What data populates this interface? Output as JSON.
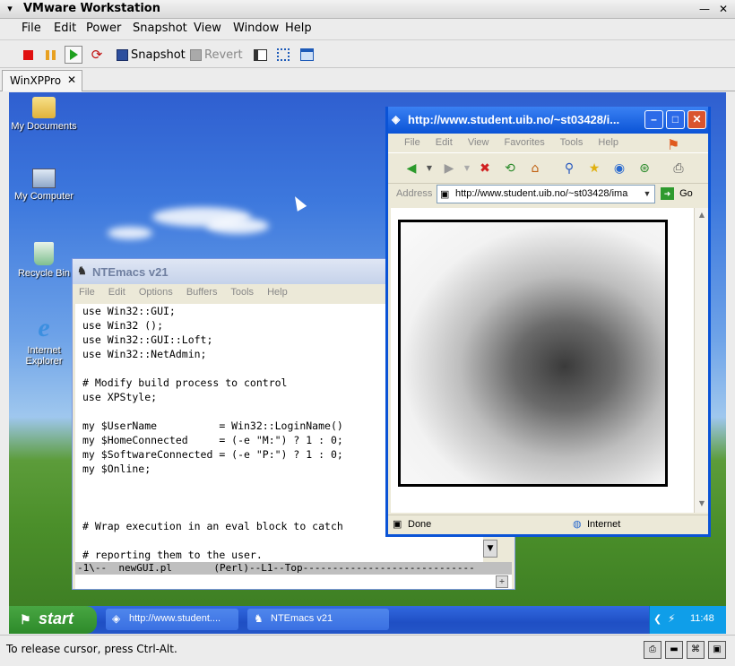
{
  "host": {
    "title": "VMware Workstation",
    "title_controls": {
      "minimize": "—",
      "close": "✕"
    },
    "menu": [
      "File",
      "Edit",
      "Power",
      "Snapshot",
      "View",
      "Window",
      "Help"
    ],
    "toolbar": {
      "snapshot_label": "Snapshot",
      "revert_label": "Revert"
    },
    "tab": {
      "label": "WinXPPro",
      "close": "✕"
    },
    "status_message": "To release cursor, press Ctrl-Alt."
  },
  "desktop": {
    "icons": [
      {
        "label_lines": [
          "My Documents"
        ],
        "icon": "folder-icon"
      },
      {
        "label_lines": [
          "My Computer"
        ],
        "icon": "computer-icon"
      },
      {
        "label_lines": [
          "Recycle Bin"
        ],
        "icon": "recycle-bin-icon"
      },
      {
        "label_lines": [
          "Internet",
          "Explorer"
        ],
        "icon": "internet-explorer-icon"
      }
    ]
  },
  "emacs": {
    "title": "NTEmacs v21",
    "menu": [
      "File",
      "Edit",
      "Options",
      "Buffers",
      "Tools",
      "Help"
    ],
    "code_lines": [
      "use Win32::GUI;",
      "use Win32 ();",
      "use Win32::GUI::Loft;",
      "use Win32::NetAdmin;",
      "",
      "# Modify build process to control",
      "use XPStyle;",
      "",
      "my $UserName          = Win32::LoginName()",
      "my $HomeConnected     = (-e \"M:\") ? 1 : 0;",
      "my $SoftwareConnected = (-e \"P:\") ? 1 : 0;",
      "my $Online;",
      "",
      "",
      "",
      "# Wrap execution in an eval block to catch",
      "",
      "# reporting them to the user."
    ],
    "mode_line": "-1\\--  newGUI.pl       (Perl)--L1--Top-----------------------------"
  },
  "ie": {
    "title": "http://www.student.uib.no/~st03428/i...",
    "menu": [
      "File",
      "Edit",
      "View",
      "Favorites",
      "Tools",
      "Help"
    ],
    "address_label": "Address",
    "address_value": "http://www.student.uib.no/~st03428/ima",
    "go_label": "Go",
    "status_text": "Done",
    "zone_text": "Internet"
  },
  "taskbar": {
    "start_label": "start",
    "tasks": [
      {
        "label": "http://www.student....",
        "icon": "ie-page-icon"
      },
      {
        "label": "NTEmacs v21",
        "icon": "emacs-icon"
      }
    ],
    "clock": "11:48"
  }
}
